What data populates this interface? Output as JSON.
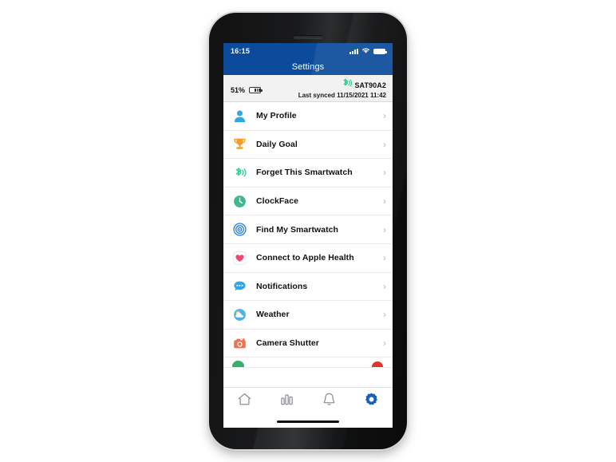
{
  "device": {
    "status_bar": {
      "time": "16:15",
      "signal_icon": "cellular-signal-icon",
      "wifi_icon": "wifi-icon",
      "battery_icon": "battery-icon"
    },
    "home_indicator": "home-indicator"
  },
  "header": {
    "title": "Settings",
    "background_color": "#0c4b9b",
    "text_color": "#ffffff"
  },
  "device_strip": {
    "battery_percent": "51%",
    "battery_icon": "watch-battery-icon",
    "bluetooth_icon": "bluetooth-icon",
    "bluetooth_color": "#2ecf8f",
    "device_name": "SAT90A2",
    "last_synced": "Last synced 11/15/2021 11:42"
  },
  "settings_rows": [
    {
      "label": "My Profile",
      "icon": "person-icon",
      "color": "#30a8e8",
      "chevron": "›"
    },
    {
      "label": "Daily Goal",
      "icon": "trophy-icon",
      "color": "#f59a28",
      "chevron": "›"
    },
    {
      "label": "Forget This Smartwatch",
      "icon": "bluetooth-signal-icon",
      "color": "#2ecf8f",
      "chevron": "›"
    },
    {
      "label": "ClockFace",
      "icon": "clock-face-icon",
      "color": "#3fb98a",
      "chevron": "›"
    },
    {
      "label": "Find My Smartwatch",
      "icon": "radar-target-icon",
      "color": "#2f84d8",
      "chevron": "›"
    },
    {
      "label": "Connect to Apple Health",
      "icon": "heart-health-icon",
      "color": "#f0486c",
      "chevron": "›"
    },
    {
      "label": "Notifications",
      "icon": "speech-bubble-icon",
      "color": "#35a5e6",
      "chevron": "›"
    },
    {
      "label": "Weather",
      "icon": "sun-cloud-icon",
      "color": "#4fb3e8",
      "chevron": "›"
    },
    {
      "label": "Camera Shutter",
      "icon": "camera-icon",
      "color": "#f2704e",
      "chevron": "›"
    }
  ],
  "partial_row": {
    "left_icon": "green-circle-icon",
    "left_color": "#36b06a",
    "right_icon": "red-circle-icon",
    "right_color": "#e0342c"
  },
  "tab_bar": {
    "items": [
      {
        "icon": "home-icon",
        "active": false
      },
      {
        "icon": "bar-chart-icon",
        "active": false
      },
      {
        "icon": "bell-icon",
        "active": false
      },
      {
        "icon": "gear-icon",
        "active": true
      }
    ],
    "inactive_color": "#8e8e93",
    "active_color": "#1560bd"
  }
}
